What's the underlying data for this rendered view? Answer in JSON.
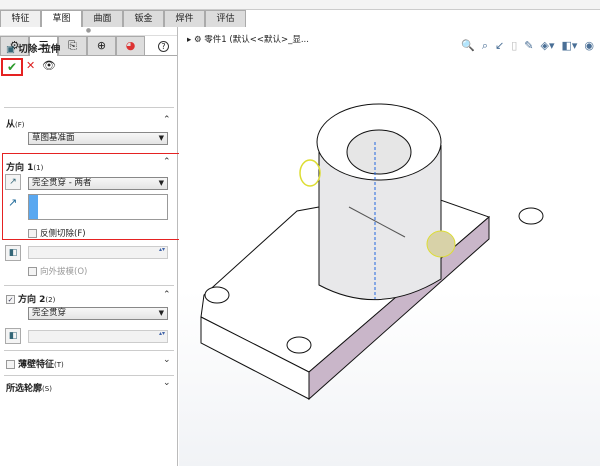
{
  "tabs": [
    "特征",
    "草图",
    "曲面",
    "钣金",
    "焊件",
    "评估"
  ],
  "panel": {
    "title": "切除-拉伸",
    "help": "?",
    "ok": "✔",
    "cancel": "✕",
    "preview": "👁",
    "from": {
      "label": "从",
      "key": "(F)",
      "value": "草图基准面"
    },
    "dir1": {
      "label": "方向 1",
      "key": "(1)",
      "value": "完全贯穿 - 两者",
      "flip": "反侧切除(F)",
      "draft": "向外拔模(O)"
    },
    "dir2": {
      "label": "方向 2",
      "key": "(2)",
      "value": "完全贯穿",
      "checked": true
    },
    "thin": {
      "label": "薄壁特征",
      "key": "(T)"
    },
    "contours": {
      "label": "所选轮廓",
      "key": "(S)"
    }
  },
  "viewport": {
    "breadcrumb": "零件1  (默认<<默认>_显..."
  }
}
